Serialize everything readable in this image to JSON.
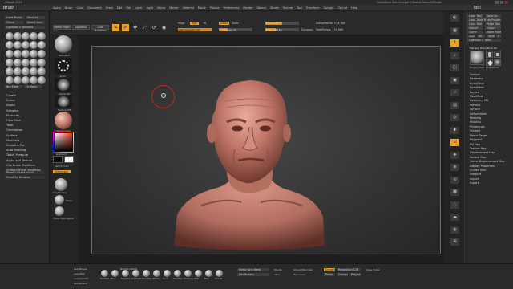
{
  "title_bar": {
    "left_text": "ZBrush 2019",
    "center_text": "",
    "right_text": "QuickSave   See-through 0   Menus   DefaultZScript"
  },
  "menu_bar": [
    "Alpha",
    "Brush",
    "Color",
    "Document",
    "Draw",
    "Edit",
    "File",
    "Layer",
    "Light",
    "Macro",
    "Marker",
    "Material",
    "Movie",
    "Picture",
    "Preferences",
    "Render",
    "Stencil",
    "Stroke",
    "Texture",
    "Tool",
    "Transform",
    "Zplugin",
    "Zscript",
    "Help"
  ],
  "brush_palette": {
    "title": "Brush",
    "top_buttons": [
      "Load Brush",
      "Save As",
      "Clone",
      "Select Icon",
      "Lightbox > Brushes"
    ],
    "size_buttons": [
      "Itm Elem",
      "Fx Mesh"
    ],
    "list": [
      "Create",
      "Curve",
      "Depth",
      "Samples",
      "Elasticity",
      "FiberMesh",
      "Twist",
      "Orientation",
      "Surface",
      "Modifiers",
      "Sculptris Pro",
      "Auto Masking",
      "Tablet Pressure",
      "Alpha and Texture",
      "Clip Brush Modifiers",
      "Smooth Brush Modifiers"
    ],
    "bottom_buttons": [
      "Reset Current Brush",
      "Reset All Brushes"
    ]
  },
  "left_shelf": {
    "home_label": "Home Page",
    "brush_labels": [
      "Standard",
      "Dots",
      "Alpha Off",
      "Texture Off"
    ],
    "material_label": "SkinShade4",
    "gradient_label": "Gradient",
    "switch_label": "SwitchColor",
    "alternate_label": "Alternate",
    "bottom_labels": [
      "ClayBuildup",
      "Move",
      "Move Topological"
    ]
  },
  "toolbar": {
    "buttons": [
      "Home Page",
      "LightBox",
      "Live Boolean"
    ],
    "icon_buttons": [
      {
        "name": "edit",
        "glyph": "✎",
        "active": true
      },
      {
        "name": "draw",
        "glyph": "✐",
        "active": true
      },
      {
        "name": "move",
        "glyph": "✥",
        "active": false
      },
      {
        "name": "scale",
        "glyph": "⤢",
        "active": false
      },
      {
        "name": "rotate",
        "glyph": "⟳",
        "active": false
      },
      {
        "name": "sphere",
        "glyph": "◉",
        "active": false
      }
    ],
    "mrgb": "Mrgb",
    "rgb": "Rgb",
    "m": "M",
    "rgb_intensity": "Rgb Intensity 100",
    "zadd": "Zadd",
    "zsub": "Zsub",
    "z_intensity": "Z Intensity 25",
    "focal_shift": "Focal Shift 0",
    "draw_size": "Draw Size 64",
    "dynamic": "Dynamic",
    "active_points": "ActivePoints: 174,380",
    "total_points": "TotalPoints: 174,380"
  },
  "right_shelf": [
    {
      "name": "bpr",
      "glyph": "◐"
    },
    {
      "name": "spix",
      "glyph": "▦"
    },
    {
      "name": "scroll",
      "glyph": "⇕"
    },
    {
      "name": "zoom",
      "glyph": "⌕"
    },
    {
      "name": "actual",
      "glyph": "▢"
    },
    {
      "name": "aahalf",
      "glyph": "▣"
    },
    {
      "name": "persp",
      "glyph": "▱"
    },
    {
      "name": "floor",
      "glyph": "▤"
    },
    {
      "name": "local",
      "glyph": "◎"
    },
    {
      "name": "xyz",
      "glyph": "✚"
    },
    {
      "name": "frame",
      "glyph": "⊡"
    },
    {
      "name": "move",
      "glyph": "✥"
    },
    {
      "name": "zoom3d",
      "glyph": "⊕"
    },
    {
      "name": "rotate",
      "glyph": "⟲"
    },
    {
      "name": "polyf",
      "glyph": "▩"
    },
    {
      "name": "transp",
      "glyph": "◌"
    },
    {
      "name": "ghost",
      "glyph": "☁"
    },
    {
      "name": "solo",
      "glyph": "◍"
    },
    {
      "name": "xpose",
      "glyph": "⊞"
    }
  ],
  "tool_palette": {
    "title": "Tool",
    "buttons": [
      "Load Tool",
      "Save As",
      "Load Tools From Project",
      "Copy Tool",
      "Paste Tool",
      "Import",
      "Export",
      "Clone",
      "Make PolyMesh3D",
      "GoZ",
      "All",
      "Visible",
      "R",
      "Lightbox > Tools"
    ],
    "current_tool": "Merged_Head_Bust 48",
    "thumb_labels": [
      "Merged_Head",
      "Cylinder3D",
      "PolyMesh3D",
      "SimpleBrush",
      "Merged_Head"
    ],
    "list": [
      "Subtool",
      "Geometry",
      "ArrayMesh",
      "NanoMesh",
      "Layers",
      "FiberMesh",
      "Geometry HD",
      "Preview",
      "Surface",
      "Deformation",
      "Masking",
      "Visibility",
      "Polygroups",
      "Contact",
      "Morph Target",
      "Polypaint",
      "UV Map",
      "Texture Map",
      "Displacement Map",
      "Normal Map",
      "Vector Displacement Map",
      "Display Properties",
      "Unified Skin",
      "Initialize",
      "Import",
      "Export"
    ]
  },
  "bottom_bar": {
    "left_labels": [
      "LazyMouse",
      "LazyStep",
      "LazySmooth",
      "LazyRadius"
    ],
    "brush_labels": [
      "Standard",
      "Move",
      "SnakeHook",
      "ClayBuildup",
      "Move Topological",
      "hPolish",
      "Pinch",
      "DamStandard",
      "TrimDynamic",
      "Inflat",
      "Blob",
      "Smooth"
    ],
    "backface_mask": "BackfaceMask",
    "mirror_label": "Mirror And Weld",
    "del_hidden": "Del Hidden",
    "smooth_normals": "SmoothNormals",
    "dynamesh": "DynaMesh",
    "resolution": "Resolution 128",
    "polish": "Polish",
    "project": "Project",
    "group": "Groups",
    "blur": "Blur 2",
    "sdiv": "SDiv",
    "del_lower": "Del Lower",
    "del_higher": "Del Higher",
    "divide": "Divide",
    "closeholes": "Close Holes"
  },
  "colors": {
    "accent": "#e8a12a",
    "skin": "#c9887b",
    "cursor": "#c0241d"
  }
}
